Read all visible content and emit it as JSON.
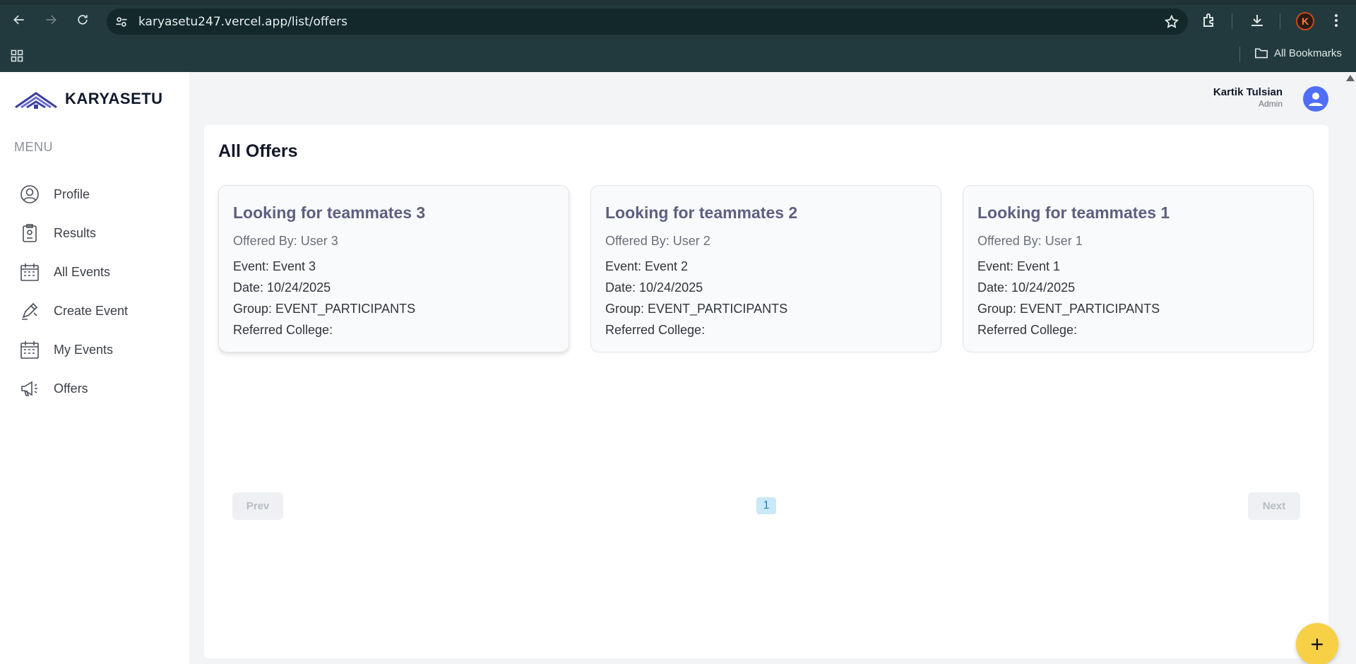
{
  "browser": {
    "url": "karyasetu247.vercel.app/list/offers",
    "bookmarks_label": "All Bookmarks",
    "profile_initial": "K"
  },
  "sidebar": {
    "logo_text": "KARYASETU",
    "menu_label": "MENU",
    "items": [
      {
        "label": "Profile",
        "icon": "user-circle-icon"
      },
      {
        "label": "Results",
        "icon": "clipboard-icon"
      },
      {
        "label": "All Events",
        "icon": "calendar-icon"
      },
      {
        "label": "Create Event",
        "icon": "pen-icon"
      },
      {
        "label": "My Events",
        "icon": "calendar-icon"
      },
      {
        "label": "Offers",
        "icon": "megaphone-icon"
      }
    ]
  },
  "header": {
    "user_name": "Kartik Tulsian",
    "user_role": "Admin"
  },
  "main": {
    "title": "All Offers",
    "offers": [
      {
        "title": "Looking for teammates 3",
        "offered_by": "Offered By: User 3",
        "event": "Event: Event 3",
        "date": "Date: 10/24/2025",
        "group": "Group: EVENT_PARTICIPANTS",
        "college": "Referred College:"
      },
      {
        "title": "Looking for teammates 2",
        "offered_by": "Offered By: User 2",
        "event": "Event: Event 2",
        "date": "Date: 10/24/2025",
        "group": "Group: EVENT_PARTICIPANTS",
        "college": "Referred College:"
      },
      {
        "title": "Looking for teammates 1",
        "offered_by": "Offered By: User 1",
        "event": "Event: Event 1",
        "date": "Date: 10/24/2025",
        "group": "Group: EVENT_PARTICIPANTS",
        "college": "Referred College:"
      }
    ],
    "pagination": {
      "prev_label": "Prev",
      "next_label": "Next",
      "current_page": "1"
    },
    "fab_label": "+"
  },
  "colors": {
    "accent": "#4f6ef7",
    "fab": "#f7d046",
    "card_title": "#5e5f7f",
    "chrome": "#223a3d"
  }
}
